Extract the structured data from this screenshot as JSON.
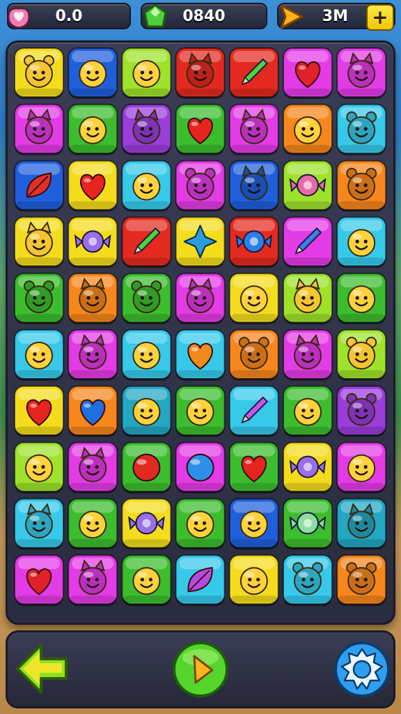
{
  "hud": {
    "lives_value": "0.0",
    "score_value": "0840",
    "moves_value": "3M",
    "add_label": "+",
    "icons": [
      "heart-pouch-icon",
      "gem-icon",
      "flag-icon",
      "plus-icon"
    ]
  },
  "colors": {
    "yellow": "#f4dc1c",
    "blue": "#1f5fdc",
    "lime": "#9ee22a",
    "red": "#e42a20",
    "magenta": "#e33be6",
    "cyan": "#36c9ea",
    "purple": "#9a3ddb",
    "green": "#3cbd2e",
    "orange": "#f7871c",
    "teal": "#23a7c2"
  },
  "board": {
    "rows": [
      [
        [
          "yellow",
          "bear"
        ],
        [
          "blue",
          "smiley"
        ],
        [
          "lime",
          "smiley"
        ],
        [
          "red",
          "cat"
        ],
        [
          "red",
          "pencil"
        ],
        [
          "magenta",
          "heart"
        ],
        [
          "magenta",
          "cat"
        ]
      ],
      [
        [
          "magenta",
          "cat"
        ],
        [
          "green",
          "smiley"
        ],
        [
          "purple",
          "cat"
        ],
        [
          "green",
          "heart"
        ],
        [
          "magenta",
          "cat"
        ],
        [
          "orange",
          "smiley"
        ],
        [
          "cyan",
          "bear"
        ]
      ],
      [
        [
          "blue",
          "leaf"
        ],
        [
          "yellow",
          "heart"
        ],
        [
          "cyan",
          "smiley"
        ],
        [
          "magenta",
          "bear"
        ],
        [
          "blue",
          "cat"
        ],
        [
          "lime",
          "candy"
        ],
        [
          "orange",
          "bear"
        ]
      ],
      [
        [
          "yellow",
          "cat"
        ],
        [
          "yellow",
          "candy"
        ],
        [
          "red",
          "pencil"
        ],
        [
          "yellow",
          "star"
        ],
        [
          "red",
          "candy"
        ],
        [
          "magenta",
          "pencil"
        ],
        [
          "cyan",
          "smiley"
        ]
      ],
      [
        [
          "green",
          "bear"
        ],
        [
          "orange",
          "cat"
        ],
        [
          "green",
          "bear"
        ],
        [
          "magenta",
          "cat"
        ],
        [
          "yellow",
          "smiley"
        ],
        [
          "lime",
          "cat"
        ],
        [
          "green",
          "smiley"
        ]
      ],
      [
        [
          "cyan",
          "smiley"
        ],
        [
          "magenta",
          "cat"
        ],
        [
          "cyan",
          "smiley"
        ],
        [
          "cyan",
          "heart"
        ],
        [
          "orange",
          "bear"
        ],
        [
          "magenta",
          "cat"
        ],
        [
          "lime",
          "bear"
        ]
      ],
      [
        [
          "yellow",
          "heart"
        ],
        [
          "orange",
          "heart"
        ],
        [
          "teal",
          "smiley"
        ],
        [
          "green",
          "smiley"
        ],
        [
          "cyan",
          "pencil"
        ],
        [
          "green",
          "smiley"
        ],
        [
          "purple",
          "bear"
        ]
      ],
      [
        [
          "lime",
          "smiley"
        ],
        [
          "magenta",
          "cat"
        ],
        [
          "green",
          "ball"
        ],
        [
          "magenta",
          "ball"
        ],
        [
          "green",
          "heart"
        ],
        [
          "yellow",
          "candy"
        ],
        [
          "magenta",
          "smiley"
        ]
      ],
      [
        [
          "cyan",
          "cat"
        ],
        [
          "green",
          "smiley"
        ],
        [
          "yellow",
          "candy"
        ],
        [
          "green",
          "smiley"
        ],
        [
          "blue",
          "smiley"
        ],
        [
          "green",
          "candy"
        ],
        [
          "teal",
          "cat"
        ]
      ],
      [
        [
          "magenta",
          "heart"
        ],
        [
          "magenta",
          "cat"
        ],
        [
          "green",
          "smiley"
        ],
        [
          "cyan",
          "leaf"
        ],
        [
          "yellow",
          "smiley"
        ],
        [
          "cyan",
          "bear"
        ],
        [
          "orange",
          "bear"
        ]
      ]
    ]
  },
  "controls": {
    "icons": [
      "back-arrow-icon",
      "play-icon",
      "settings-gear-icon"
    ]
  }
}
